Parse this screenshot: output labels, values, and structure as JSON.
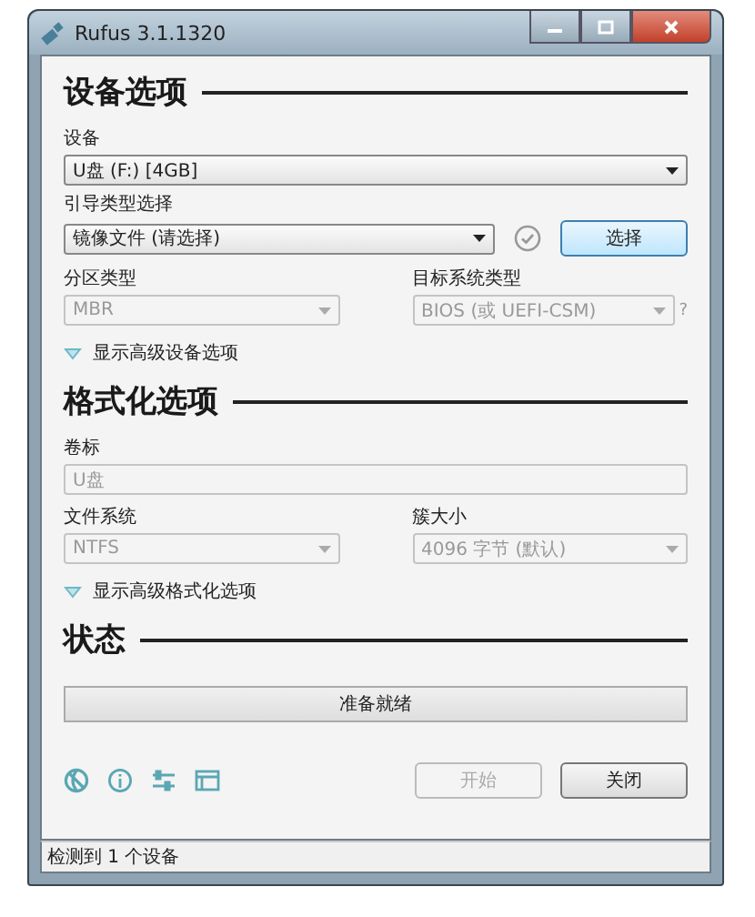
{
  "window": {
    "title": "Rufus 3.1.1320"
  },
  "device_options": {
    "heading": "设备选项",
    "device": {
      "label": "设备",
      "value": "U盘 (F:) [4GB]",
      "disabled": false
    },
    "boot_selection": {
      "label": "引导类型选择",
      "value": "镜像文件 (请选择)",
      "disabled": false,
      "button": "选择"
    },
    "partition_scheme": {
      "label": "分区类型",
      "value": "MBR",
      "disabled": true
    },
    "target_system": {
      "label": "目标系统类型",
      "value": "BIOS (或 UEFI-CSM)",
      "disabled": true
    },
    "help_mark": "?",
    "advanced_toggle": {
      "label": "显示高级设备选项",
      "expanded": false
    }
  },
  "format_options": {
    "heading": "格式化选项",
    "volume_label": {
      "label": "卷标",
      "value": "U盘",
      "disabled": true
    },
    "file_system": {
      "label": "文件系统",
      "value": "NTFS",
      "disabled": true
    },
    "cluster_size": {
      "label": "簇大小",
      "value": "4096 字节 (默认)",
      "disabled": true
    },
    "advanced_toggle": {
      "label": "显示高级格式化选项",
      "expanded": false
    }
  },
  "status": {
    "heading": "状态",
    "text": "准备就绪",
    "level": 0
  },
  "buttons": [
    {
      "label": "开始",
      "disabled": true
    },
    {
      "label": "关闭",
      "disabled": false
    }
  ],
  "status_bar": "检测到 1 个设备"
}
